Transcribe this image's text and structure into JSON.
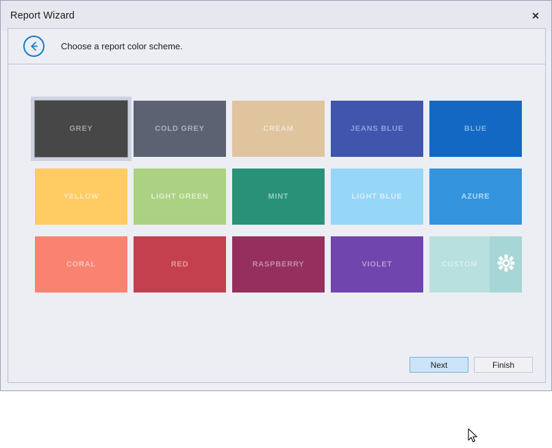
{
  "window": {
    "title": "Report Wizard",
    "close_icon": "close-icon",
    "close_glyph": "✕"
  },
  "header": {
    "back_icon": "back-arrow-circle-icon",
    "caption": "Choose a report color scheme."
  },
  "colors": {
    "dialog_background": "#eceef3",
    "titlebar_background": "#e7e8ef",
    "window_border": "#9a9fbb",
    "panel_border": "#b9bed2",
    "accent_blue": "#1878c8",
    "selection_frame": "#ced2e0",
    "button_hover": "#cce4f7"
  },
  "schemes": [
    {
      "id": "grey",
      "label": "GREY",
      "color": "#474747",
      "text_color": "#9aa0ab",
      "selected": true
    },
    {
      "id": "cold-grey",
      "label": "COLD GREY",
      "color": "#5c6272",
      "text_color": "#a8b0bf",
      "selected": false
    },
    {
      "id": "cream",
      "label": "CREAM",
      "color": "#dfc49e",
      "text_color": "#f0e5d6",
      "selected": false
    },
    {
      "id": "jeans-blue",
      "label": "JEANS BLUE",
      "color": "#4055ab",
      "text_color": "#8fa1dd",
      "selected": false
    },
    {
      "id": "blue",
      "label": "BLUE",
      "color": "#1268c3",
      "text_color": "#7fb1e4",
      "selected": false
    },
    {
      "id": "yellow",
      "label": "YELLOW",
      "color": "#ffcb63",
      "text_color": "#fee9bd",
      "selected": false
    },
    {
      "id": "light-green",
      "label": "LIGHT GREEN",
      "color": "#abd182",
      "text_color": "#e0eed2",
      "selected": false
    },
    {
      "id": "mint",
      "label": "MINT",
      "color": "#2a9179",
      "text_color": "#8fd0c1",
      "selected": false
    },
    {
      "id": "light-blue",
      "label": "LIGHT BLUE",
      "color": "#96d6f6",
      "text_color": "#dbeefc",
      "selected": false
    },
    {
      "id": "azure",
      "label": "AZURE",
      "color": "#3494dd",
      "text_color": "#b3d9f3",
      "selected": false
    },
    {
      "id": "coral",
      "label": "CORAL",
      "color": "#f98271",
      "text_color": "#fcc8bf",
      "selected": false
    },
    {
      "id": "red",
      "label": "RED",
      "color": "#c4404e",
      "text_color": "#e39aa1",
      "selected": false
    },
    {
      "id": "raspberry",
      "label": "RASPBERRY",
      "color": "#95305e",
      "text_color": "#c58ba6",
      "selected": false
    },
    {
      "id": "violet",
      "label": "VIOLET",
      "color": "#7145ae",
      "text_color": "#b69ad8",
      "selected": false
    },
    {
      "id": "custom",
      "label": "CUSTOM",
      "color": "#b7e0de",
      "color_secondary": "#a6d6d5",
      "text_color": "#d8f0ef",
      "selected": false,
      "gear_icon": "gear-icon"
    }
  ],
  "footer": {
    "next_label": "Next",
    "finish_label": "Finish"
  }
}
